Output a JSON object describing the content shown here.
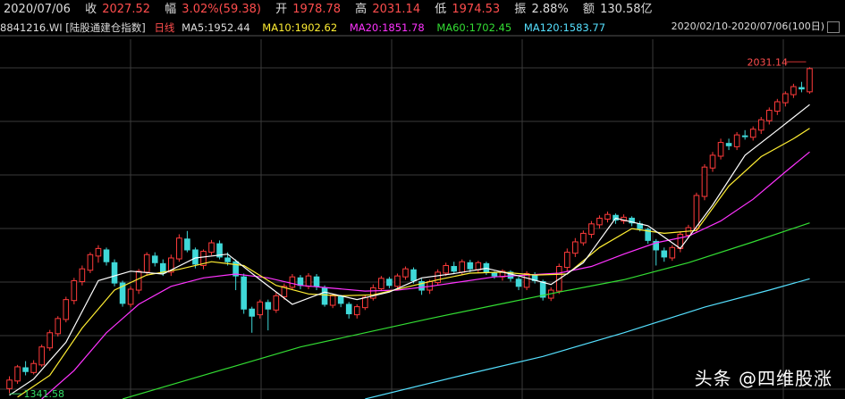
{
  "header": {
    "date": "2020/07/06",
    "close_label": "收",
    "close": "2027.52",
    "change_label": "幅",
    "change": "3.02%(59.38)",
    "open_label": "开",
    "open": "1978.78",
    "high_label": "高",
    "high": "2031.14",
    "low_label": "低",
    "low": "1974.53",
    "amp_label": "振",
    "amp": "2.88%",
    "amount_label": "额",
    "amount": "130.58亿"
  },
  "info": {
    "code": "8841216.WI",
    "name": "[陆股通建仓指数]",
    "period": "日线",
    "ma5": "MA5:1952.44",
    "ma10": "MA10:1902.62",
    "ma20": "MA20:1851.78",
    "ma60": "MA60:1702.45",
    "ma120": "MA120:1583.77",
    "range": "2020/02/10-2020/07/06(100日)"
  },
  "colors": {
    "up": "#ff3b3b",
    "down": "#3fd8d8",
    "ma5": "#ffffff",
    "ma10": "#ffee33",
    "ma20": "#ff33ff",
    "ma60": "#33dd33",
    "ma120": "#55e0ff",
    "grid": "#3a3a3a"
  },
  "chart_data": {
    "type": "candlestick",
    "ylim": [
      1330,
      2090
    ],
    "candles": [
      [
        1352,
        1370,
        1342,
        1378
      ],
      [
        1368,
        1398,
        1362,
        1402
      ],
      [
        1396,
        1388,
        1380,
        1410
      ],
      [
        1386,
        1405,
        1382,
        1412
      ],
      [
        1402,
        1440,
        1398,
        1445
      ],
      [
        1438,
        1470,
        1432,
        1476
      ],
      [
        1468,
        1500,
        1462,
        1505
      ],
      [
        1498,
        1540,
        1492,
        1546
      ],
      [
        1538,
        1580,
        1530,
        1586
      ],
      [
        1578,
        1605,
        1570,
        1612
      ],
      [
        1602,
        1635,
        1596,
        1640
      ],
      [
        1632,
        1648,
        1618,
        1655
      ],
      [
        1645,
        1620,
        1612,
        1650
      ],
      [
        1618,
        1575,
        1568,
        1625
      ],
      [
        1575,
        1532,
        1525,
        1580
      ],
      [
        1530,
        1562,
        1524,
        1568
      ],
      [
        1560,
        1600,
        1552,
        1605
      ],
      [
        1598,
        1635,
        1590,
        1640
      ],
      [
        1632,
        1618,
        1610,
        1640
      ],
      [
        1616,
        1596,
        1590,
        1625
      ],
      [
        1598,
        1628,
        1590,
        1635
      ],
      [
        1626,
        1670,
        1620,
        1678
      ],
      [
        1668,
        1645,
        1640,
        1685
      ],
      [
        1645,
        1615,
        1606,
        1650
      ],
      [
        1612,
        1642,
        1604,
        1646
      ],
      [
        1640,
        1660,
        1634,
        1666
      ],
      [
        1658,
        1630,
        1625,
        1665
      ],
      [
        1628,
        1620,
        1612,
        1640
      ],
      [
        1620,
        1590,
        1560,
        1625
      ],
      [
        1588,
        1520,
        1510,
        1595
      ],
      [
        1520,
        1505,
        1470,
        1525
      ],
      [
        1508,
        1535,
        1500,
        1540
      ],
      [
        1534,
        1520,
        1475,
        1540
      ],
      [
        1518,
        1548,
        1512,
        1555
      ],
      [
        1546,
        1568,
        1540,
        1574
      ],
      [
        1566,
        1588,
        1560,
        1594
      ],
      [
        1586,
        1570,
        1562,
        1592
      ],
      [
        1568,
        1590,
        1562,
        1596
      ],
      [
        1588,
        1568,
        1560,
        1594
      ],
      [
        1565,
        1530,
        1525,
        1570
      ],
      [
        1528,
        1548,
        1522,
        1552
      ],
      [
        1546,
        1532,
        1524,
        1550
      ],
      [
        1530,
        1510,
        1500,
        1535
      ],
      [
        1508,
        1525,
        1500,
        1530
      ],
      [
        1523,
        1545,
        1518,
        1550
      ],
      [
        1543,
        1565,
        1538,
        1572
      ],
      [
        1563,
        1585,
        1558,
        1590
      ],
      [
        1583,
        1570,
        1564,
        1588
      ],
      [
        1568,
        1590,
        1562,
        1595
      ],
      [
        1588,
        1605,
        1582,
        1610
      ],
      [
        1603,
        1580,
        1574,
        1608
      ],
      [
        1578,
        1560,
        1550,
        1584
      ],
      [
        1560,
        1578,
        1552,
        1582
      ],
      [
        1576,
        1598,
        1570,
        1604
      ],
      [
        1596,
        1612,
        1590,
        1618
      ],
      [
        1610,
        1600,
        1594,
        1620
      ],
      [
        1598,
        1620,
        1592,
        1625
      ],
      [
        1618,
        1605,
        1598,
        1624
      ],
      [
        1603,
        1618,
        1596,
        1622
      ],
      [
        1616,
        1598,
        1592,
        1620
      ],
      [
        1596,
        1590,
        1584,
        1600
      ],
      [
        1588,
        1600,
        1580,
        1604
      ],
      [
        1598,
        1585,
        1578,
        1602
      ],
      [
        1583,
        1568,
        1560,
        1588
      ],
      [
        1566,
        1595,
        1560,
        1600
      ],
      [
        1593,
        1580,
        1574,
        1598
      ],
      [
        1578,
        1545,
        1538,
        1582
      ],
      [
        1543,
        1560,
        1537,
        1566
      ],
      [
        1558,
        1610,
        1552,
        1616
      ],
      [
        1608,
        1640,
        1600,
        1648
      ],
      [
        1638,
        1662,
        1630,
        1670
      ],
      [
        1660,
        1680,
        1654,
        1686
      ],
      [
        1678,
        1700,
        1670,
        1706
      ],
      [
        1698,
        1712,
        1690,
        1718
      ],
      [
        1710,
        1720,
        1703,
        1726
      ],
      [
        1718,
        1708,
        1700,
        1722
      ],
      [
        1706,
        1714,
        1700,
        1720
      ],
      [
        1712,
        1702,
        1695,
        1716
      ],
      [
        1700,
        1690,
        1684,
        1706
      ],
      [
        1688,
        1665,
        1658,
        1692
      ],
      [
        1663,
        1645,
        1612,
        1668
      ],
      [
        1643,
        1630,
        1620,
        1650
      ],
      [
        1628,
        1650,
        1622,
        1655
      ],
      [
        1648,
        1678,
        1640,
        1684
      ],
      [
        1676,
        1692,
        1670,
        1698
      ],
      [
        1690,
        1760,
        1684,
        1766
      ],
      [
        1758,
        1820,
        1750,
        1826
      ],
      [
        1818,
        1845,
        1810,
        1852
      ],
      [
        1843,
        1872,
        1836,
        1880
      ],
      [
        1870,
        1865,
        1856,
        1880
      ],
      [
        1863,
        1888,
        1856,
        1894
      ],
      [
        1886,
        1885,
        1878,
        1898
      ],
      [
        1883,
        1900,
        1876,
        1906
      ],
      [
        1898,
        1920,
        1890,
        1926
      ],
      [
        1918,
        1940,
        1910,
        1946
      ],
      [
        1938,
        1958,
        1930,
        1964
      ],
      [
        1956,
        1975,
        1948,
        1980
      ],
      [
        1973,
        1990,
        1966,
        1996
      ],
      [
        1988,
        1985,
        1978,
        2000
      ],
      [
        1979,
        2028,
        1975,
        2031
      ]
    ],
    "ma_lines": {
      "ma5": [
        [
          0,
          1338
        ],
        [
          3,
          1372
        ],
        [
          7,
          1450
        ],
        [
          11,
          1580
        ],
        [
          15,
          1600
        ],
        [
          19,
          1594
        ],
        [
          23,
          1628
        ],
        [
          27,
          1636
        ],
        [
          31,
          1582
        ],
        [
          35,
          1530
        ],
        [
          39,
          1556
        ],
        [
          43,
          1540
        ],
        [
          47,
          1556
        ],
        [
          51,
          1586
        ],
        [
          55,
          1595
        ],
        [
          59,
          1606
        ],
        [
          63,
          1590
        ],
        [
          67,
          1572
        ],
        [
          71,
          1618
        ],
        [
          75,
          1712
        ],
        [
          79,
          1696
        ],
        [
          83,
          1648
        ],
        [
          87,
          1740
        ],
        [
          91,
          1845
        ],
        [
          95,
          1898
        ],
        [
          99,
          1952
        ]
      ],
      "ma10": [
        [
          1,
          1334
        ],
        [
          5,
          1380
        ],
        [
          9,
          1480
        ],
        [
          13,
          1560
        ],
        [
          17,
          1592
        ],
        [
          21,
          1604
        ],
        [
          25,
          1620
        ],
        [
          29,
          1612
        ],
        [
          33,
          1570
        ],
        [
          37,
          1552
        ],
        [
          41,
          1548
        ],
        [
          45,
          1550
        ],
        [
          49,
          1566
        ],
        [
          53,
          1582
        ],
        [
          57,
          1596
        ],
        [
          61,
          1598
        ],
        [
          65,
          1592
        ],
        [
          69,
          1594
        ],
        [
          73,
          1650
        ],
        [
          77,
          1690
        ],
        [
          81,
          1680
        ],
        [
          85,
          1686
        ],
        [
          89,
          1780
        ],
        [
          93,
          1842
        ],
        [
          97,
          1880
        ],
        [
          99,
          1902
        ]
      ],
      "ma20": [
        [
          4,
          1330
        ],
        [
          8,
          1390
        ],
        [
          12,
          1470
        ],
        [
          16,
          1530
        ],
        [
          20,
          1568
        ],
        [
          24,
          1586
        ],
        [
          28,
          1594
        ],
        [
          32,
          1586
        ],
        [
          36,
          1570
        ],
        [
          40,
          1564
        ],
        [
          44,
          1558
        ],
        [
          48,
          1560
        ],
        [
          52,
          1568
        ],
        [
          56,
          1578
        ],
        [
          60,
          1588
        ],
        [
          64,
          1592
        ],
        [
          68,
          1596
        ],
        [
          72,
          1610
        ],
        [
          76,
          1636
        ],
        [
          80,
          1660
        ],
        [
          84,
          1674
        ],
        [
          88,
          1706
        ],
        [
          92,
          1752
        ],
        [
          96,
          1810
        ],
        [
          99,
          1852
        ]
      ],
      "ma60": [
        [
          14,
          1330
        ],
        [
          20,
          1360
        ],
        [
          28,
          1400
        ],
        [
          36,
          1440
        ],
        [
          44,
          1470
        ],
        [
          52,
          1500
        ],
        [
          60,
          1528
        ],
        [
          68,
          1556
        ],
        [
          76,
          1582
        ],
        [
          84,
          1618
        ],
        [
          92,
          1662
        ],
        [
          99,
          1702
        ]
      ],
      "ma120": [
        [
          44,
          1330
        ],
        [
          56,
          1380
        ],
        [
          66,
          1420
        ],
        [
          76,
          1470
        ],
        [
          86,
          1524
        ],
        [
          94,
          1560
        ],
        [
          99,
          1584
        ]
      ]
    },
    "high_label": "2031.14",
    "low_label": "1341.58"
  },
  "watermark": "头条 @四维股涨"
}
